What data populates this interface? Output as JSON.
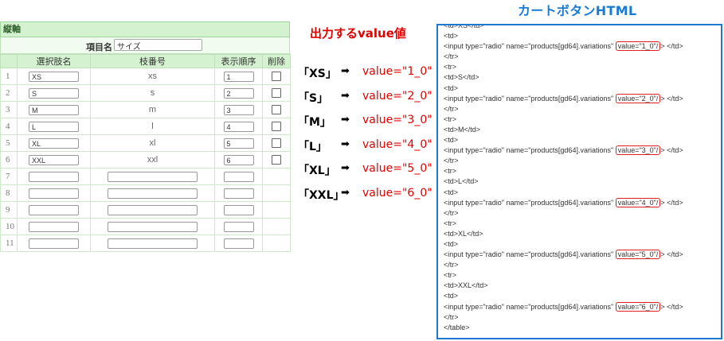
{
  "axis_panel": {
    "header": "縦軸",
    "item_name_label": "項目名",
    "item_name_value": "サイズ",
    "columns": [
      "",
      "選択肢名",
      "枝番号",
      "表示順序",
      "削除"
    ],
    "rows": [
      {
        "num": "1",
        "name": "XS",
        "branch": "xs",
        "order": "1",
        "deletable": true
      },
      {
        "num": "2",
        "name": "S",
        "branch": "s",
        "order": "2",
        "deletable": true
      },
      {
        "num": "3",
        "name": "M",
        "branch": "m",
        "order": "3",
        "deletable": true
      },
      {
        "num": "4",
        "name": "L",
        "branch": "l",
        "order": "4",
        "deletable": true
      },
      {
        "num": "5",
        "name": "XL",
        "branch": "xl",
        "order": "5",
        "deletable": true
      },
      {
        "num": "6",
        "name": "XXL",
        "branch": "xxl",
        "order": "6",
        "deletable": true
      },
      {
        "num": "7",
        "name": "",
        "branch": "",
        "order": "",
        "deletable": false
      },
      {
        "num": "8",
        "name": "",
        "branch": "",
        "order": "",
        "deletable": false
      },
      {
        "num": "9",
        "name": "",
        "branch": "",
        "order": "",
        "deletable": false
      },
      {
        "num": "10",
        "name": "",
        "branch": "",
        "order": "",
        "deletable": false
      },
      {
        "num": "11",
        "name": "",
        "branch": "",
        "order": "",
        "deletable": false
      }
    ]
  },
  "output": {
    "title": "出力するvalue値",
    "mappings": [
      {
        "key": "「XS」",
        "arrow": "➡",
        "value": "value=\"1_0\""
      },
      {
        "key": "「S」",
        "arrow": "➡",
        "value": "value=\"2_0\""
      },
      {
        "key": "「M」",
        "arrow": "➡",
        "value": "value=\"3_0\""
      },
      {
        "key": "「L」",
        "arrow": "➡",
        "value": "value=\"4_0\""
      },
      {
        "key": "「XL」",
        "arrow": "➡",
        "value": "value=\"5_0\""
      },
      {
        "key": "「XXL」",
        "arrow": "➡",
        "value": "value=\"6_0\""
      }
    ]
  },
  "cart_html": {
    "title": "カートボタンHTML",
    "input_prefix": "<input type=\"radio\" name=\"products[gd64].variations\"",
    "input_suffix": "</td>",
    "first_line": "<td>XS</td>",
    "blocks": [
      {
        "size_line": "",
        "value": "value=\"1_0\"/"
      },
      {
        "size_line": "<td>S</td>",
        "value": "value=\"2_0\"/"
      },
      {
        "size_line": "<td>M</td>",
        "value": "value=\"3_0\"/"
      },
      {
        "size_line": "<td>L</td>",
        "value": "value=\"4_0\"/"
      },
      {
        "size_line": "<td>XL</td>",
        "value": "value=\"5_0\"/"
      },
      {
        "size_line": "<td>XXL</td>",
        "value": "value=\"6_0\"/"
      }
    ],
    "td_open": "<td>",
    "tr_close": "</tr>",
    "tr_open": "<tr>",
    "table_close": "</table>",
    "gt": ">"
  },
  "colors": {
    "header_green": "#d4f2d0",
    "accent_red": "#e00000",
    "accent_blue": "#1f78d2"
  }
}
